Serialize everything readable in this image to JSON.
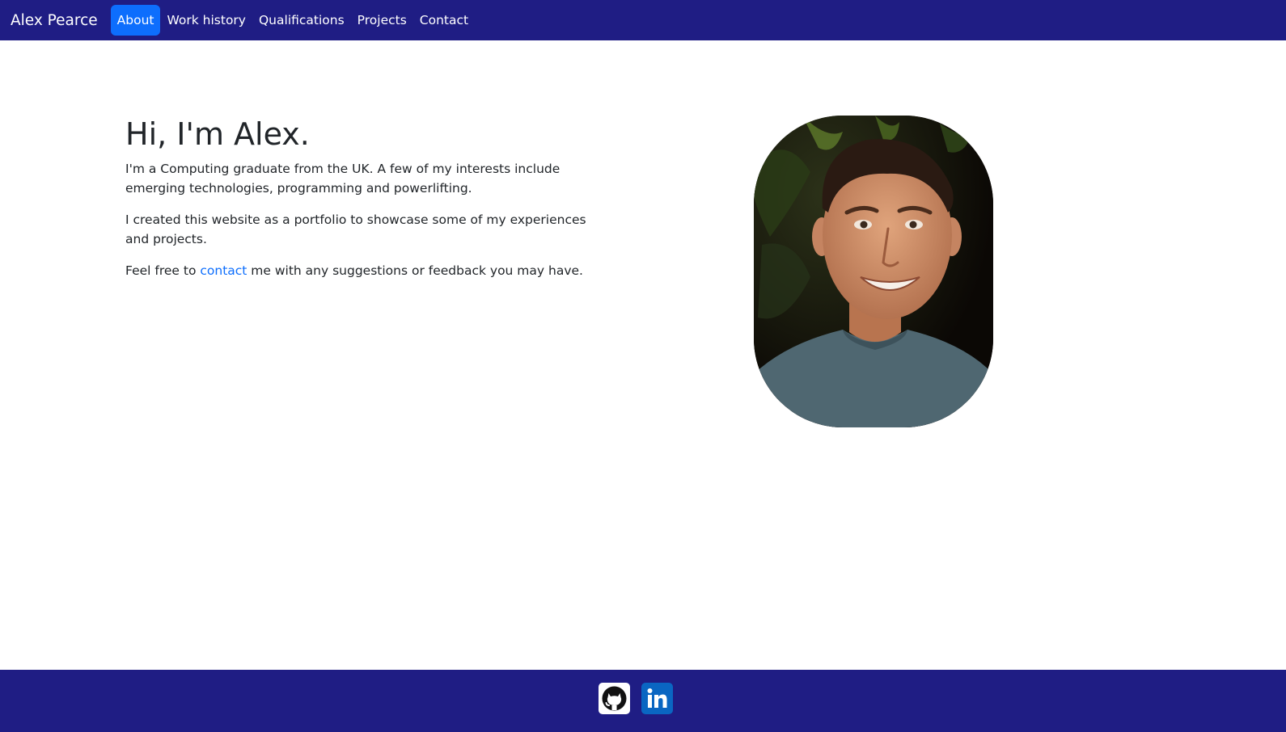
{
  "nav": {
    "brand": "Alex Pearce",
    "items": [
      {
        "label": "About",
        "active": true
      },
      {
        "label": "Work history",
        "active": false
      },
      {
        "label": "Qualifications",
        "active": false
      },
      {
        "label": "Projects",
        "active": false
      },
      {
        "label": "Contact",
        "active": false
      }
    ]
  },
  "hero": {
    "heading": "Hi, I'm Alex.",
    "paragraph1": "I'm a Computing graduate from the UK. A few of my interests include emerging technologies, programming and powerlifting.",
    "paragraph2": "I created this website as a portfolio to showcase some of my experiences and projects.",
    "paragraph3_before": "Feel free to ",
    "paragraph3_link": "contact",
    "paragraph3_after": " me with any suggestions or feedback you may have."
  },
  "portrait": {
    "icon": "person-photo"
  },
  "footer": {
    "links": [
      {
        "name": "github",
        "icon": "github-icon"
      },
      {
        "name": "linkedin",
        "icon": "linkedin-icon"
      }
    ]
  },
  "colors": {
    "navbar_bg": "#1f1d84",
    "active_nav_bg": "#0d6efd",
    "link": "#0d6efd",
    "linkedin_blue": "#0a66c2"
  }
}
